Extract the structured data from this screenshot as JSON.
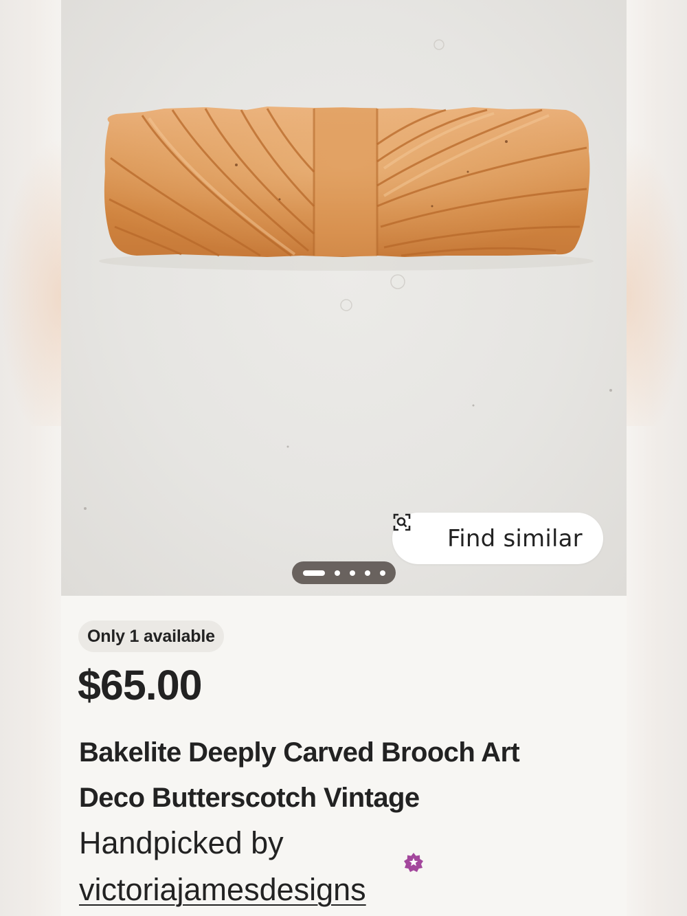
{
  "listing": {
    "image": {
      "alt": "Butterscotch carved bakelite bar brooch on white background",
      "pager": {
        "total": 5,
        "current": 1
      }
    },
    "find_similar": {
      "label": "Find similar",
      "icon": "visual-search-icon"
    },
    "availability": "Only 1 available",
    "price": "$65.00",
    "title": "Bakelite Deeply Carved Brooch Art Deco Butterscotch Vintage",
    "handpicked_prefix": "Handpicked by",
    "shop_name": "victoriajamesdesigns",
    "star_seller_icon": "star-seller-badge-icon"
  },
  "colors": {
    "accent_purple": "#a3479c",
    "text_dark": "#222222",
    "brooch": "#d9904f"
  }
}
